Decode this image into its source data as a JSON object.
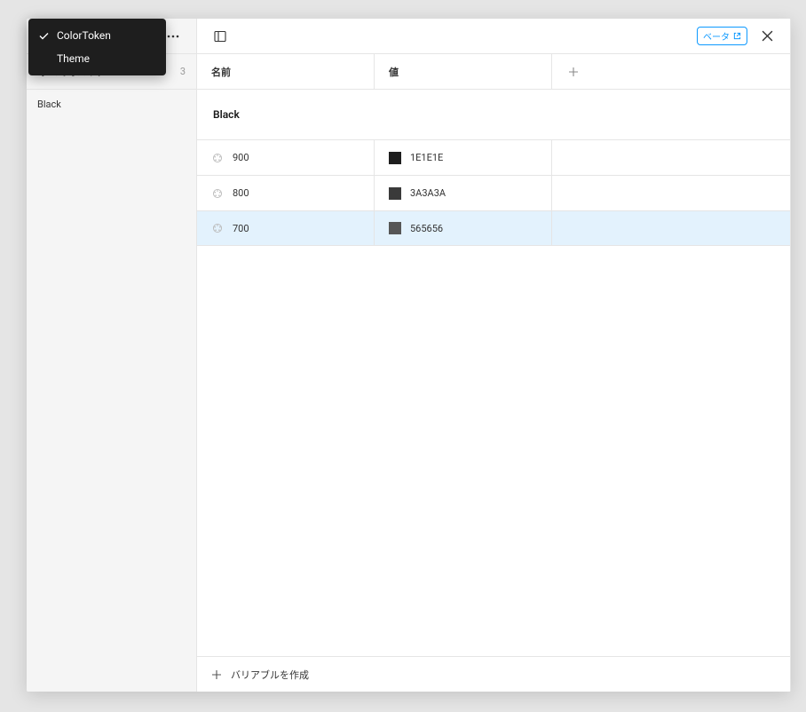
{
  "sidebar": {
    "all_variables_obscured": "すべてのバリア…",
    "count": "3",
    "items": [
      {
        "label": "Black"
      }
    ]
  },
  "toolbar": {
    "beta_label": "ベータ"
  },
  "columns": {
    "name": "名前",
    "value": "値"
  },
  "group": {
    "title": "Black"
  },
  "rows": [
    {
      "name": "900",
      "value_label": "1E1E1E",
      "swatch": "#1E1E1E",
      "selected": false
    },
    {
      "name": "800",
      "value_label": "3A3A3A",
      "swatch": "#3A3A3A",
      "selected": false
    },
    {
      "name": "700",
      "value_label": "565656",
      "swatch": "#565656",
      "selected": true
    }
  ],
  "footer": {
    "create_label": "バリアブルを作成"
  },
  "dropdown": {
    "items": [
      {
        "label": "ColorToken",
        "checked": true
      },
      {
        "label": "Theme",
        "checked": false
      }
    ]
  }
}
